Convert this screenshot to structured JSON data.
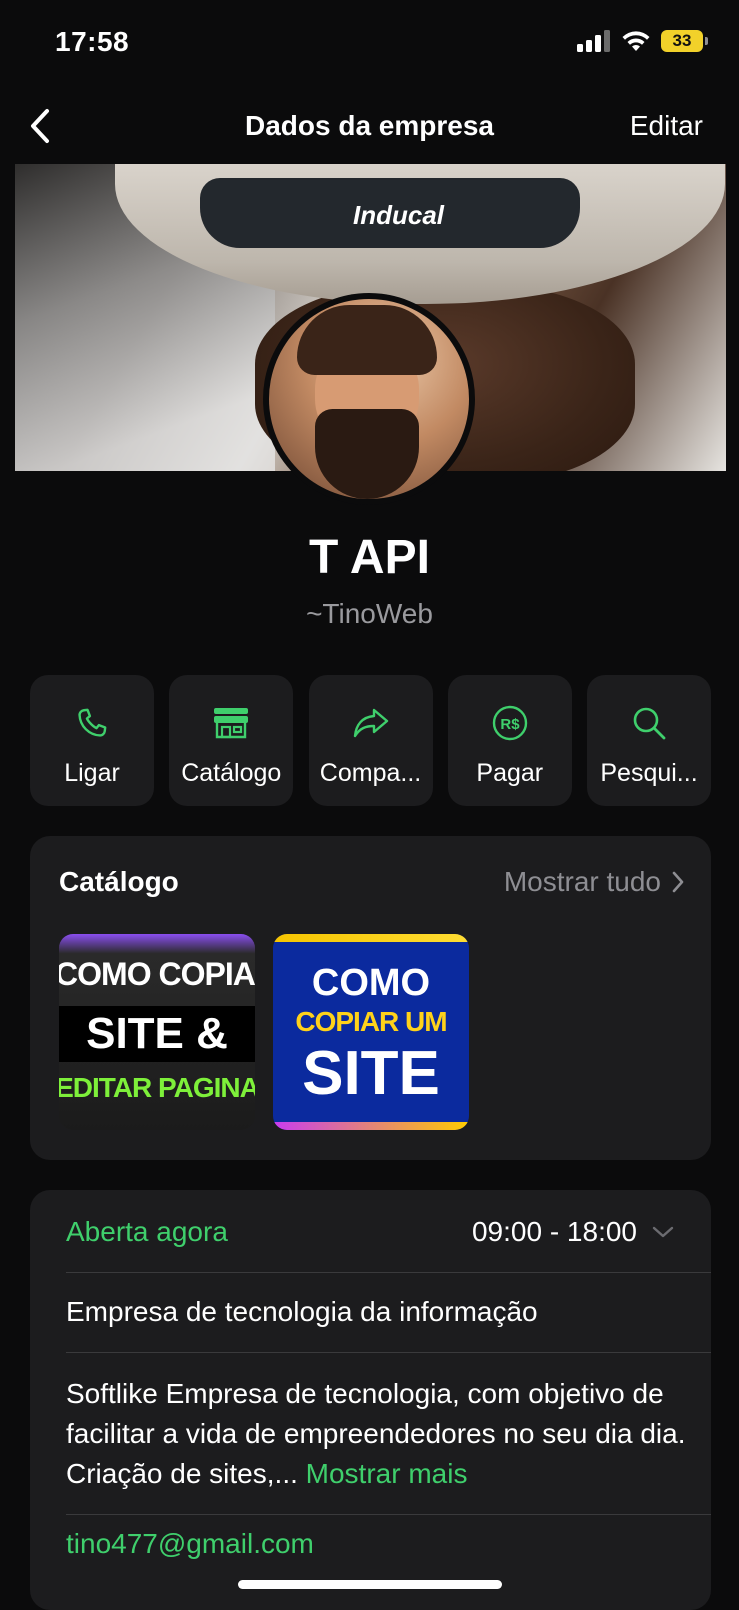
{
  "status_bar": {
    "time": "17:58",
    "battery": "33"
  },
  "nav": {
    "title": "Dados da empresa",
    "edit": "Editar"
  },
  "cover": {
    "brand_text": "Inducal"
  },
  "profile": {
    "name": "T API",
    "subtitle": "~TinoWeb"
  },
  "actions": [
    {
      "label": "Ligar",
      "icon": "phone-icon"
    },
    {
      "label": "Catálogo",
      "icon": "storefront-icon"
    },
    {
      "label": "Compa...",
      "icon": "share-icon"
    },
    {
      "label": "Pagar",
      "icon": "pay-icon",
      "icon_text": "R$"
    },
    {
      "label": "Pesqui...",
      "icon": "search-icon"
    }
  ],
  "catalog": {
    "title": "Catálogo",
    "show_all": "Mostrar tudo",
    "items": [
      {
        "line1": "COMO COPIAR",
        "line2": "SITE &",
        "line3": "EDITAR PAGINA"
      },
      {
        "line1": "COMO",
        "line2": "COPIAR UM",
        "line3": "SITE"
      }
    ]
  },
  "info": {
    "hours_status": "Aberta agora",
    "hours_range": "09:00 - 18:00",
    "category": "Empresa de tecnologia da informação",
    "description": "Softlike Empresa de tecnologia, com objetivo de facilitar a vida de empreendedores no seu dia dia. Criação de sites,...",
    "show_more": "Mostrar mais",
    "email": "tino477@gmail.com"
  },
  "colors": {
    "accent": "#3fcf6c",
    "background": "#0b0b0c",
    "card": "#1c1c1e",
    "battery": "#f2d12a"
  }
}
